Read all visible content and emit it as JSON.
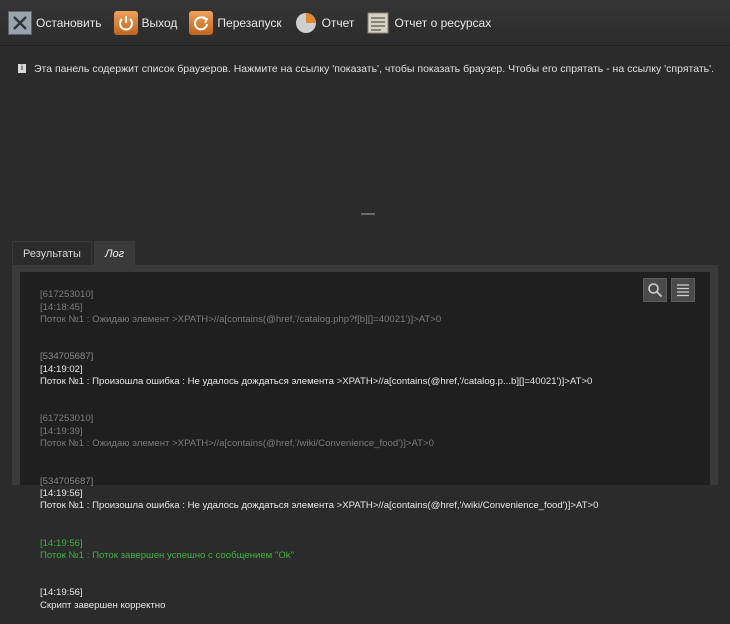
{
  "toolbar": {
    "stop": "Остановить",
    "exit": "Выход",
    "restart": "Перезапуск",
    "report": "Отчет",
    "resource_report": "Отчет о ресурсах"
  },
  "info": {
    "icon": "info-icon",
    "text": "Эта панель содержит список браузеров. Нажмите на ссылку 'показать', чтобы показать браузер. Чтобы его спрятать - на ссылку 'спрятать'."
  },
  "tabs": [
    {
      "label": "Результаты"
    },
    {
      "label": "Лог"
    }
  ],
  "log": [
    {
      "id": "[617253010]",
      "time": "[14:18:45]",
      "text": "Поток №1 : Ожидаю элемент >XPATH>//a[contains(@href,'/catalog.php?f[b][]=40021')]>AT>0",
      "style": "dim"
    },
    {
      "id": "[534705687]",
      "time": "[14:19:02]",
      "text": "Поток №1 : Произошла ошибка : Не удалось дождаться элемента >XPATH>//a[contains(@href,'/catalog.p...b][]=40021')]>AT>0",
      "style": "norm"
    },
    {
      "id": "[617253010]",
      "time": "[14:19:39]",
      "text": "Поток №1 : Ожидаю элемент >XPATH>//a[contains(@href,'/wiki/Convenience_food')]>AT>0",
      "style": "dim"
    },
    {
      "id": "[534705687]",
      "time": "[14:19:56]",
      "text": "Поток №1 : Произошла ошибка : Не удалось дождаться элемента >XPATH>//a[contains(@href,'/wiki/Convenience_food')]>AT>0",
      "style": "norm"
    },
    {
      "id": "",
      "time": "[14:19:56]",
      "text": "Поток №1 : Поток завершен успешно с сообщением \"Ok\"",
      "style": "green"
    },
    {
      "id": "",
      "time": "[14:19:56]",
      "text": "Скрипт завершен корректно",
      "style": "norm"
    }
  ]
}
